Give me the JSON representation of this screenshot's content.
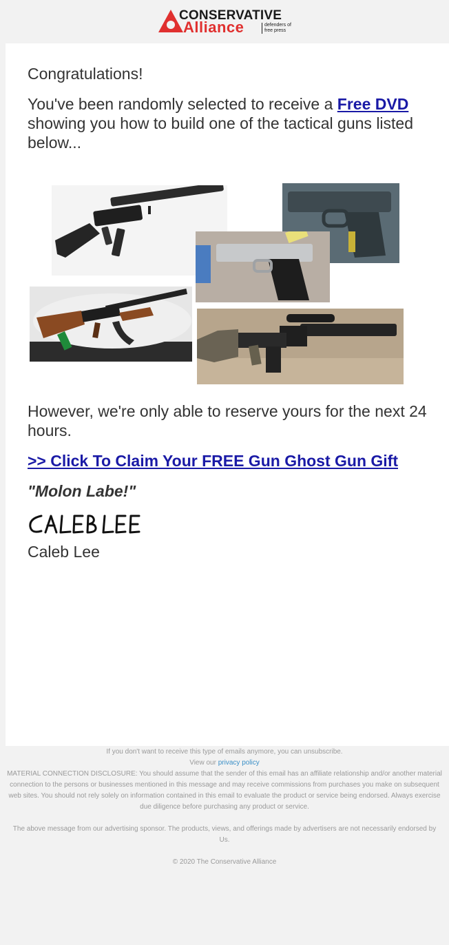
{
  "header": {
    "logo_line1": "CONSERVATIVE",
    "logo_line2": "Alliance",
    "logo_tagline": "defenders of free press"
  },
  "email": {
    "greeting": "Congratulations!",
    "intro_before": "You've been randomly selected to receive a ",
    "intro_link": "Free DVD",
    "intro_after": " showing you how to build one of the tactical guns listed below...",
    "however": "However, we're only able to reserve yours for the next 24 hours.",
    "claim_link": ">> Click To Claim Your FREE Gun Ghost Gun Gift",
    "motto": "\"Molon Labe!\"",
    "signature_script": "Caleb Lee",
    "signature_name": "Caleb Lee"
  },
  "footer": {
    "unsubscribe": "If you don't want to receive this type of emails anymore, you can unsubscribe.",
    "view_our": "View our ",
    "privacy_link": "privacy policy",
    "disclosure": "MATERIAL CONNECTION DISCLOSURE: You should assume that the sender of this email has an affiliate relationship and/or another material connection to the persons or businesses mentioned in this message and may receive commissions from purchases you make on subsequent web sites. You should not rely solely on information contained in this email to evaluate the product or service being endorsed. Always exercise due diligence before purchasing any product or service.",
    "sponsor_note": "The above message from our advertising sponsor. The products, views, and offerings made by advertisers are not necessarily endorsed by Us.",
    "copyright": "© 2020 The Conservative Alliance"
  },
  "colors": {
    "brand_red": "#e0302f",
    "link_blue": "#1a1aa6",
    "footer_link": "#3a8fc7"
  },
  "images": [
    "ar15-rifle-photo",
    "pistol-frame-photo",
    "silver-1911-pistol-photo",
    "ak47-rifle-photo",
    "ar10-rifle-photo"
  ]
}
